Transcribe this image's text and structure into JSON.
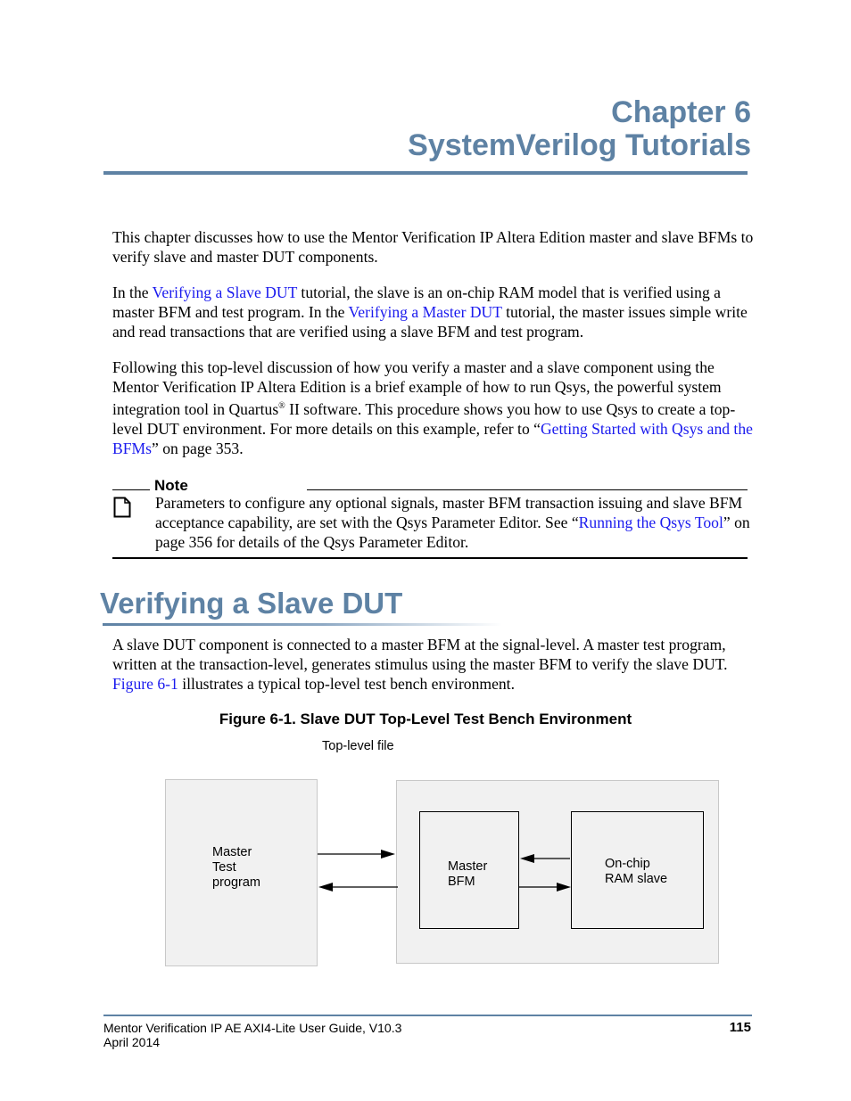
{
  "chapter": {
    "line1": "Chapter 6",
    "line2": "SystemVerilog Tutorials"
  },
  "intro": {
    "p1": "This chapter discusses how to use the Mentor Verification IP Altera Edition master and slave BFMs to verify slave and master DUT components.",
    "p2": {
      "t1": "In the ",
      "link1": "Verifying a Slave DUT",
      "t2": " tutorial, the slave is an on-chip RAM model that is verified using a master BFM and test program. In the ",
      "link2": "Verifying a Master DUT",
      "t3": " tutorial, the master issues simple write and read transactions that are verified using a slave BFM and test program."
    },
    "p3": {
      "t1": "Following this top-level discussion of how you verify a master and a slave component using the Mentor Verification IP Altera Edition is a brief example of how to run Qsys, the powerful system integration tool in Quartus",
      "reg": "®",
      "t2": " II software. This procedure shows you how to use Qsys to create a top-level DUT environment. For more details on this example, refer to “",
      "link": "Getting Started with Qsys and the BFMs",
      "t3": "” on page 353."
    }
  },
  "note": {
    "label": "Note",
    "icon": "page-icon",
    "t1": "Parameters to configure any optional signals, master BFM transaction issuing and slave BFM acceptance capability, are set with the Qsys Parameter Editor. See “",
    "link": "Running the Qsys Tool",
    "t2": "” on page 356 for details of the Qsys Parameter Editor."
  },
  "section": {
    "title": "Verifying a Slave DUT",
    "p1": {
      "t1": "A slave DUT component is connected to a master BFM at the signal-level. A master test program, written at the transaction-level, generates stimulus using the master BFM to verify the slave DUT. ",
      "link": "Figure 6-1",
      "t2": " illustrates a typical top-level test bench environment."
    }
  },
  "figure": {
    "caption": "Figure 6-1. Slave DUT Top-Level Test Bench Environment",
    "top_level_label": "Top-level file",
    "test_program": [
      "Master",
      "Test",
      "program"
    ],
    "master_bfm": [
      "Master",
      "BFM"
    ],
    "ram_slave": [
      "On-chip",
      "RAM slave"
    ]
  },
  "footer": {
    "guide": "Mentor Verification IP AE AXI4-Lite User Guide, V10.3",
    "date": "April 2014",
    "page": "115"
  },
  "colors": {
    "heading": "#5e82a4",
    "link": "#1a1aee",
    "diagram_fill": "#f1f1f1"
  }
}
